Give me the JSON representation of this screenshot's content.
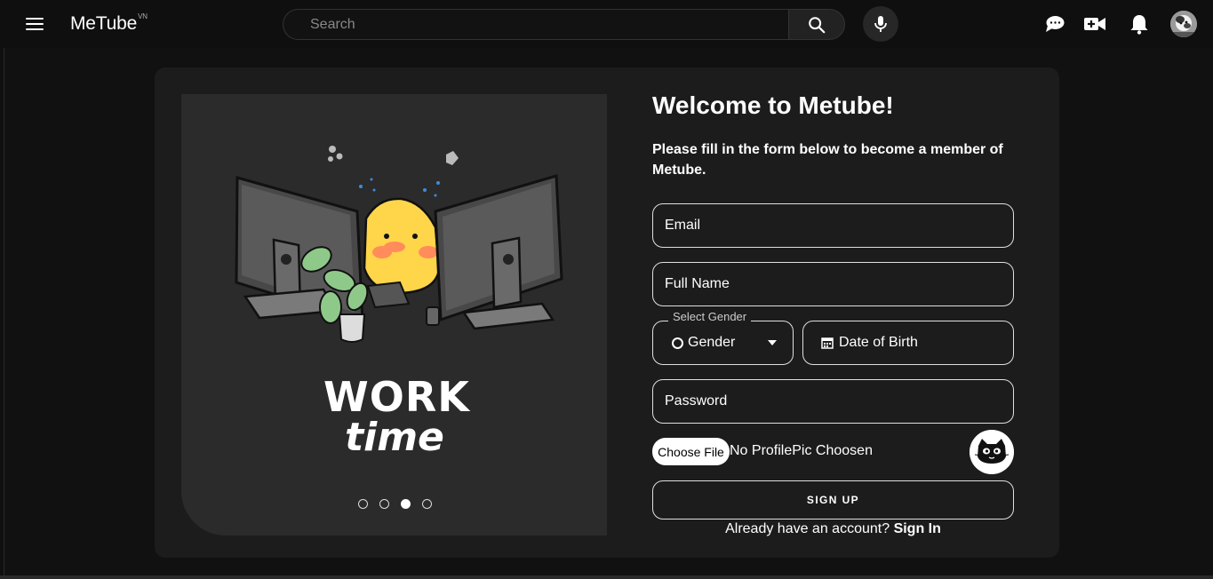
{
  "header": {
    "logo": "MeTube",
    "logo_suffix": "VN",
    "search_placeholder": "Search"
  },
  "slider": {
    "illustration_text_line1": "WORK",
    "illustration_text_line2": "time",
    "slide_count": 4,
    "active_slide": 3
  },
  "form": {
    "title": "Welcome to Metube!",
    "subtitle": "Please fill in the form below to become a member of Metube.",
    "email_label": "Email",
    "fullname_label": "Full Name",
    "gender_legend": "Select Gender",
    "gender_value": "Gender",
    "dob_label": "Date of Birth",
    "password_label": "Password",
    "file_button": "Choose File",
    "file_status": "No ProfilePic Choosen",
    "signup_label": "SIGN UP",
    "signin_prompt": "Already have an account?",
    "signin_link": "Sign In"
  },
  "icons": {
    "menu": "menu-icon",
    "search": "search-icon",
    "mic": "mic-icon",
    "chat": "chat-icon",
    "create": "video-add-icon",
    "notifications": "bell-icon",
    "calendar": "calendar-icon"
  },
  "colors": {
    "background": "#0f0f0f",
    "card": "#1c1c1c",
    "panel": "#2b2b2b",
    "accent_char": "#ffd54a"
  }
}
